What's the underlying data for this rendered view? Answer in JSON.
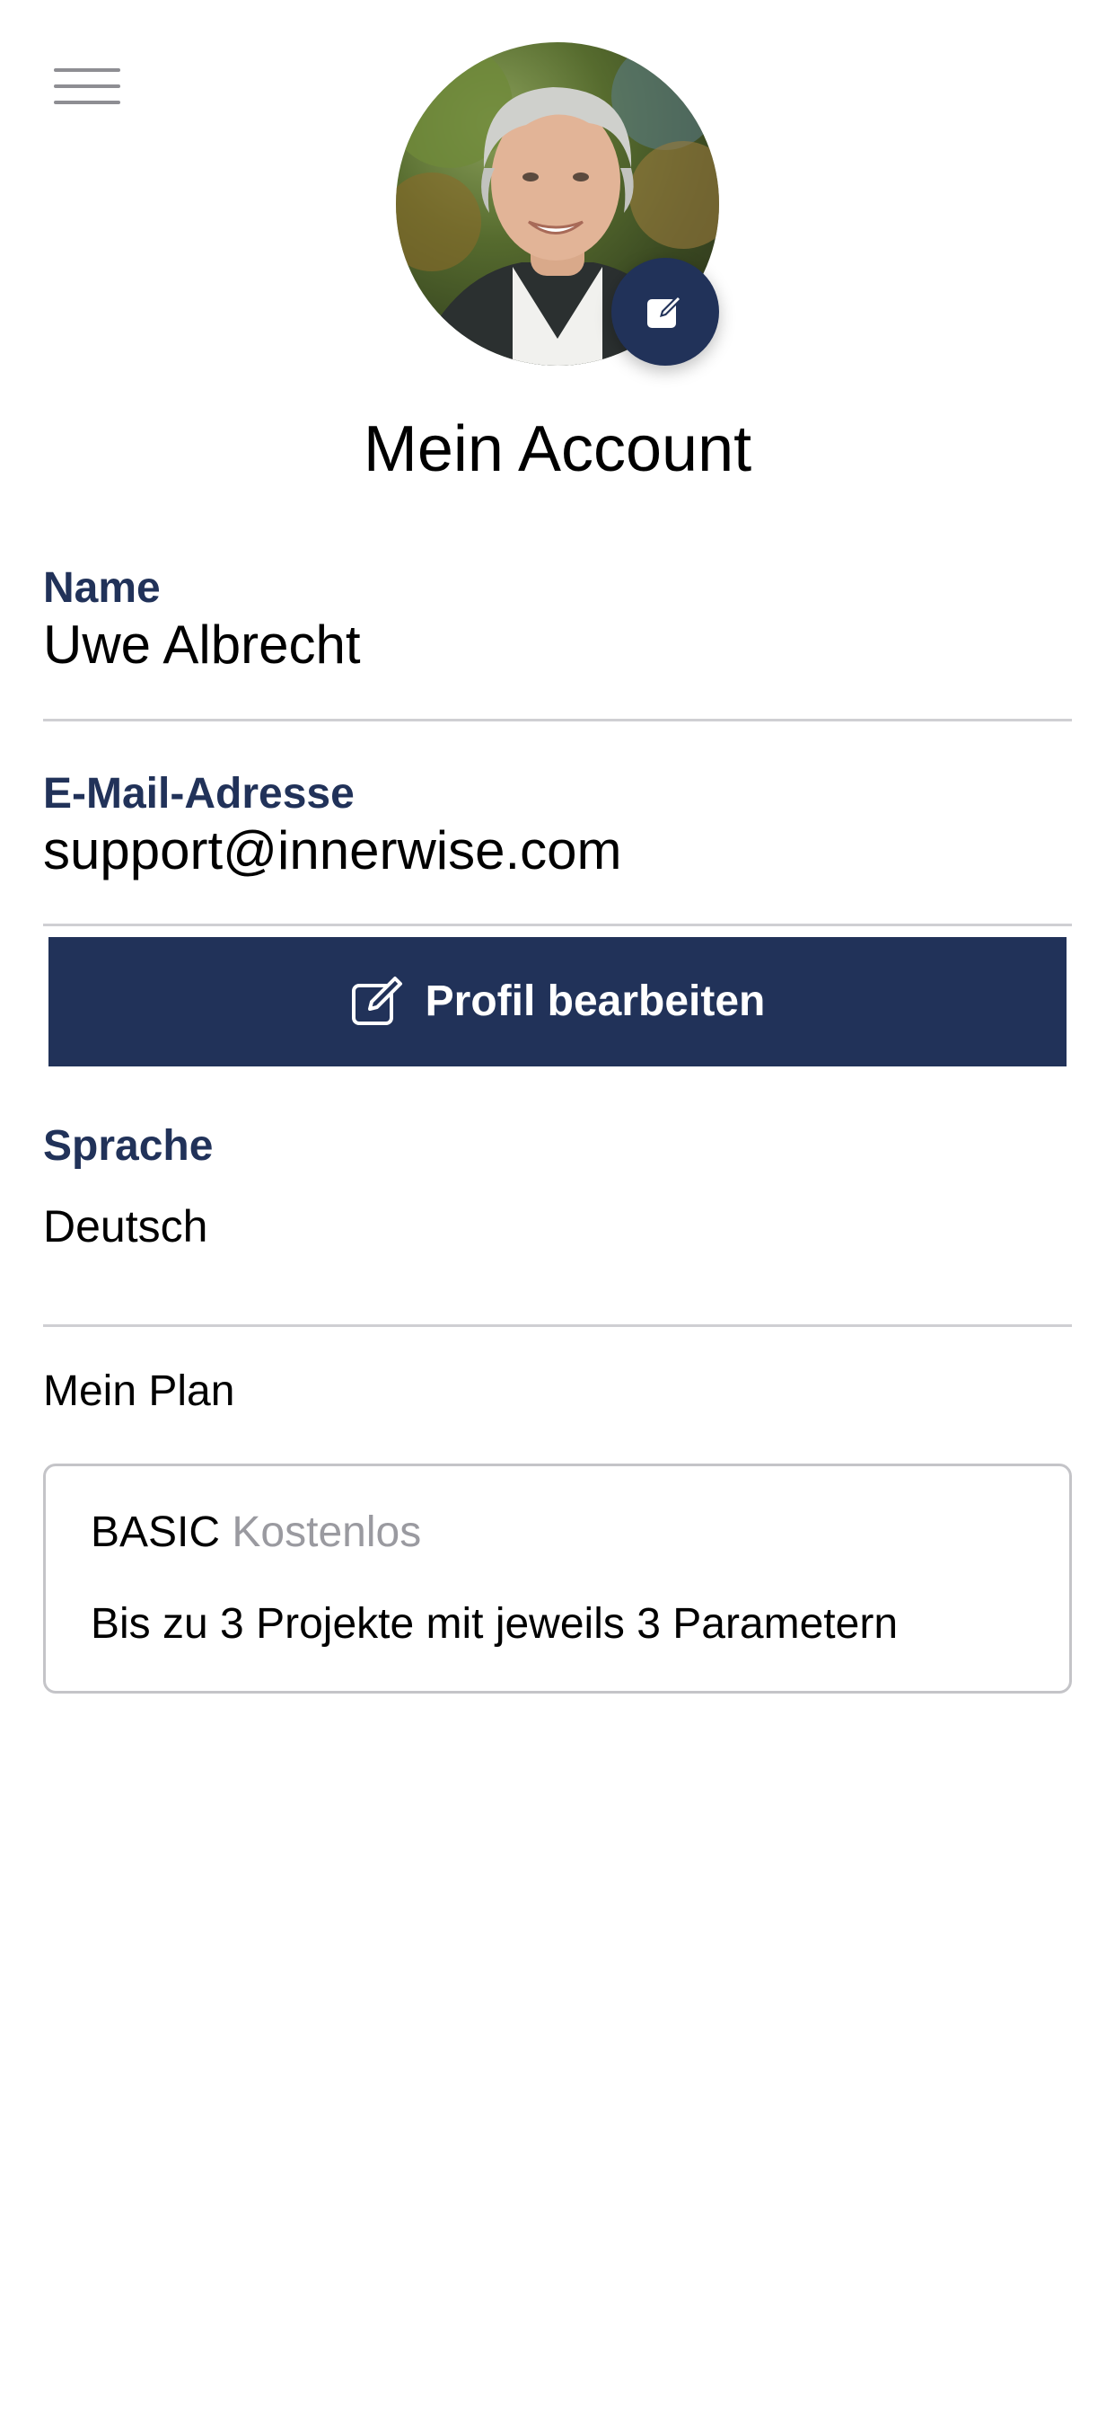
{
  "header": {
    "menu_icon": "hamburger-menu-icon",
    "title": "Mein Account"
  },
  "profile": {
    "avatar_edit_icon": "edit-square-icon",
    "name_label": "Name",
    "name_value": "Uwe Albrecht",
    "email_label": "E-Mail-Adresse",
    "email_value": "support@innerwise.com",
    "edit_button_label": "Profil bearbeiten",
    "edit_button_icon": "edit-square-icon"
  },
  "language": {
    "label": "Sprache",
    "value": "Deutsch"
  },
  "plan": {
    "heading": "Mein Plan",
    "name": "BASIC",
    "price": "Kostenlos",
    "description": "Bis zu 3 Projekte mit jeweils 3 Parametern"
  },
  "colors": {
    "accent": "#213259",
    "divider": "#cfcfd3",
    "muted_text": "#9a9aa0"
  }
}
